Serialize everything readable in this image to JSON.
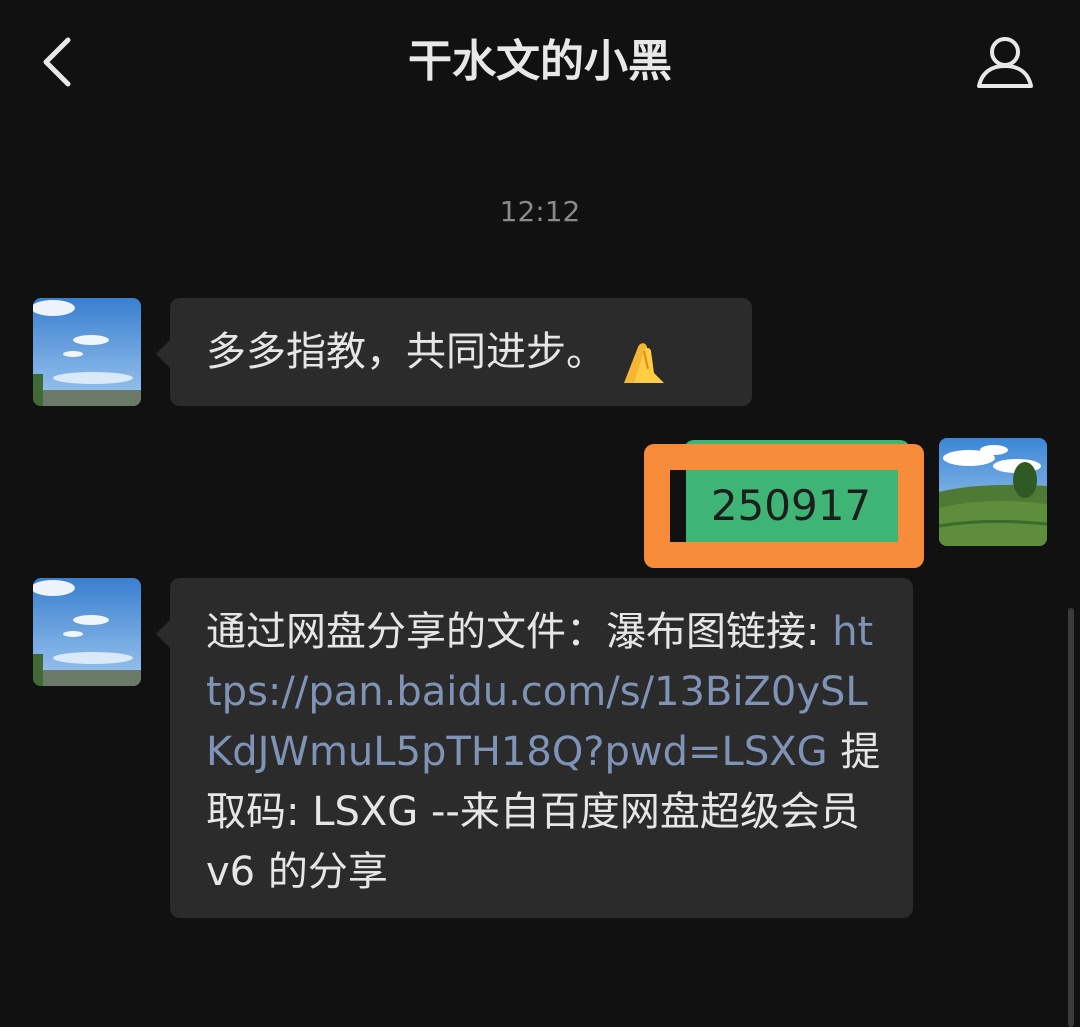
{
  "header": {
    "back_icon": "chevron-left-icon",
    "title": "干水文的小黑",
    "profile_icon": "person-icon"
  },
  "chat": {
    "timestamp": "12:12",
    "messages": [
      {
        "side": "received",
        "text": "多多指教，共同进步。",
        "emoji": "folded-hands"
      },
      {
        "side": "sent",
        "text": "250917",
        "bubble_color": "#3eb575",
        "highlight_color": "#f68c3a"
      },
      {
        "side": "received",
        "text_prefix": "通过网盘分享的文件：瀑布图链接: ",
        "link": "https://pan.baidu.com/s/13BiZ0ySLKdJWmuL5pTH18Q?pwd=LSXG",
        "text_suffix": " 提取码: LSXG --来自百度网盘超级会员 v6 的分享"
      }
    ]
  },
  "colors": {
    "background": "#111111",
    "bubble_received": "#2b2b2b",
    "link": "#7f93b7"
  }
}
